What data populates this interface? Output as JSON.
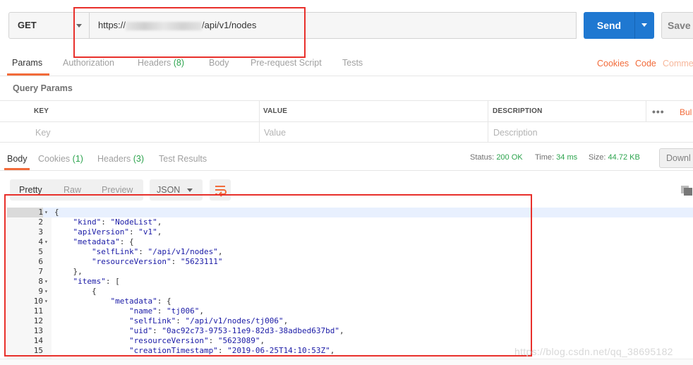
{
  "request": {
    "method": "GET",
    "url_prefix": "https://",
    "url_suffix": "/api/v1/nodes",
    "send_label": "Send",
    "save_label": "Save"
  },
  "request_tabs": {
    "params": "Params",
    "authorization": "Authorization",
    "headers": "Headers",
    "headers_count": "(8)",
    "body": "Body",
    "prerequest": "Pre-request Script",
    "tests": "Tests",
    "cookies": "Cookies",
    "code": "Code",
    "comments": "Comme"
  },
  "query_params": {
    "title": "Query Params",
    "headers": {
      "key": "KEY",
      "value": "VALUE",
      "description": "DESCRIPTION"
    },
    "placeholders": {
      "key": "Key",
      "value": "Value",
      "description": "Description"
    },
    "menu": "•••",
    "bulk": "Bul"
  },
  "response_tabs": {
    "body": "Body",
    "cookies": "Cookies",
    "cookies_count": "(1)",
    "headers": "Headers",
    "headers_count": "(3)",
    "test_results": "Test Results"
  },
  "response_status": {
    "status_label": "Status:",
    "status_value": "200 OK",
    "time_label": "Time:",
    "time_value": "34 ms",
    "size_label": "Size:",
    "size_value": "44.72 KB",
    "download": "Downl"
  },
  "view": {
    "pretty": "Pretty",
    "raw": "Raw",
    "preview": "Preview",
    "format": "JSON"
  },
  "code_lines": [
    {
      "n": "1",
      "fold": true,
      "indent": 0,
      "parts": [
        [
          "p",
          "{"
        ]
      ]
    },
    {
      "n": "2",
      "fold": false,
      "indent": 1,
      "parts": [
        [
          "k",
          "\"kind\""
        ],
        [
          "p",
          ": "
        ],
        [
          "s",
          "\"NodeList\""
        ],
        [
          "p",
          ","
        ]
      ]
    },
    {
      "n": "3",
      "fold": false,
      "indent": 1,
      "parts": [
        [
          "k",
          "\"apiVersion\""
        ],
        [
          "p",
          ": "
        ],
        [
          "s",
          "\"v1\""
        ],
        [
          "p",
          ","
        ]
      ]
    },
    {
      "n": "4",
      "fold": true,
      "indent": 1,
      "parts": [
        [
          "k",
          "\"metadata\""
        ],
        [
          "p",
          ": {"
        ]
      ]
    },
    {
      "n": "5",
      "fold": false,
      "indent": 2,
      "parts": [
        [
          "k",
          "\"selfLink\""
        ],
        [
          "p",
          ": "
        ],
        [
          "s",
          "\"/api/v1/nodes\""
        ],
        [
          "p",
          ","
        ]
      ]
    },
    {
      "n": "6",
      "fold": false,
      "indent": 2,
      "parts": [
        [
          "k",
          "\"resourceVersion\""
        ],
        [
          "p",
          ": "
        ],
        [
          "s",
          "\"5623111\""
        ]
      ]
    },
    {
      "n": "7",
      "fold": false,
      "indent": 1,
      "parts": [
        [
          "p",
          "},"
        ]
      ]
    },
    {
      "n": "8",
      "fold": true,
      "indent": 1,
      "parts": [
        [
          "k",
          "\"items\""
        ],
        [
          "p",
          ": ["
        ]
      ]
    },
    {
      "n": "9",
      "fold": true,
      "indent": 2,
      "parts": [
        [
          "p",
          "{"
        ]
      ]
    },
    {
      "n": "10",
      "fold": true,
      "indent": 3,
      "parts": [
        [
          "k",
          "\"metadata\""
        ],
        [
          "p",
          ": {"
        ]
      ]
    },
    {
      "n": "11",
      "fold": false,
      "indent": 4,
      "parts": [
        [
          "k",
          "\"name\""
        ],
        [
          "p",
          ": "
        ],
        [
          "s",
          "\"tj006\""
        ],
        [
          "p",
          ","
        ]
      ]
    },
    {
      "n": "12",
      "fold": false,
      "indent": 4,
      "parts": [
        [
          "k",
          "\"selfLink\""
        ],
        [
          "p",
          ": "
        ],
        [
          "s",
          "\"/api/v1/nodes/tj006\""
        ],
        [
          "p",
          ","
        ]
      ]
    },
    {
      "n": "13",
      "fold": false,
      "indent": 4,
      "parts": [
        [
          "k",
          "\"uid\""
        ],
        [
          "p",
          ": "
        ],
        [
          "s",
          "\"0ac92c73-9753-11e9-82d3-38adbed637bd\""
        ],
        [
          "p",
          ","
        ]
      ]
    },
    {
      "n": "14",
      "fold": false,
      "indent": 4,
      "parts": [
        [
          "k",
          "\"resourceVersion\""
        ],
        [
          "p",
          ": "
        ],
        [
          "s",
          "\"5623089\""
        ],
        [
          "p",
          ","
        ]
      ]
    },
    {
      "n": "15",
      "fold": false,
      "indent": 4,
      "parts": [
        [
          "k",
          "\"creationTimestamp\""
        ],
        [
          "p",
          ": "
        ],
        [
          "s",
          "\"2019-06-25T14:10:53Z\""
        ],
        [
          "p",
          ","
        ]
      ]
    }
  ],
  "watermark": "https://blog.csdn.net/qq_38695182",
  "colors": {
    "send": "#1f78d1",
    "accent": "#f26b3a",
    "success": "#2da44e",
    "highlight_box": "#e8302b"
  },
  "icons": {
    "method_dropdown": "chevron-down-icon",
    "send_dropdown": "chevron-down-icon",
    "format_dropdown": "chevron-down-icon",
    "wrap": "wrap-lines-icon",
    "copy": "copy-icon"
  }
}
